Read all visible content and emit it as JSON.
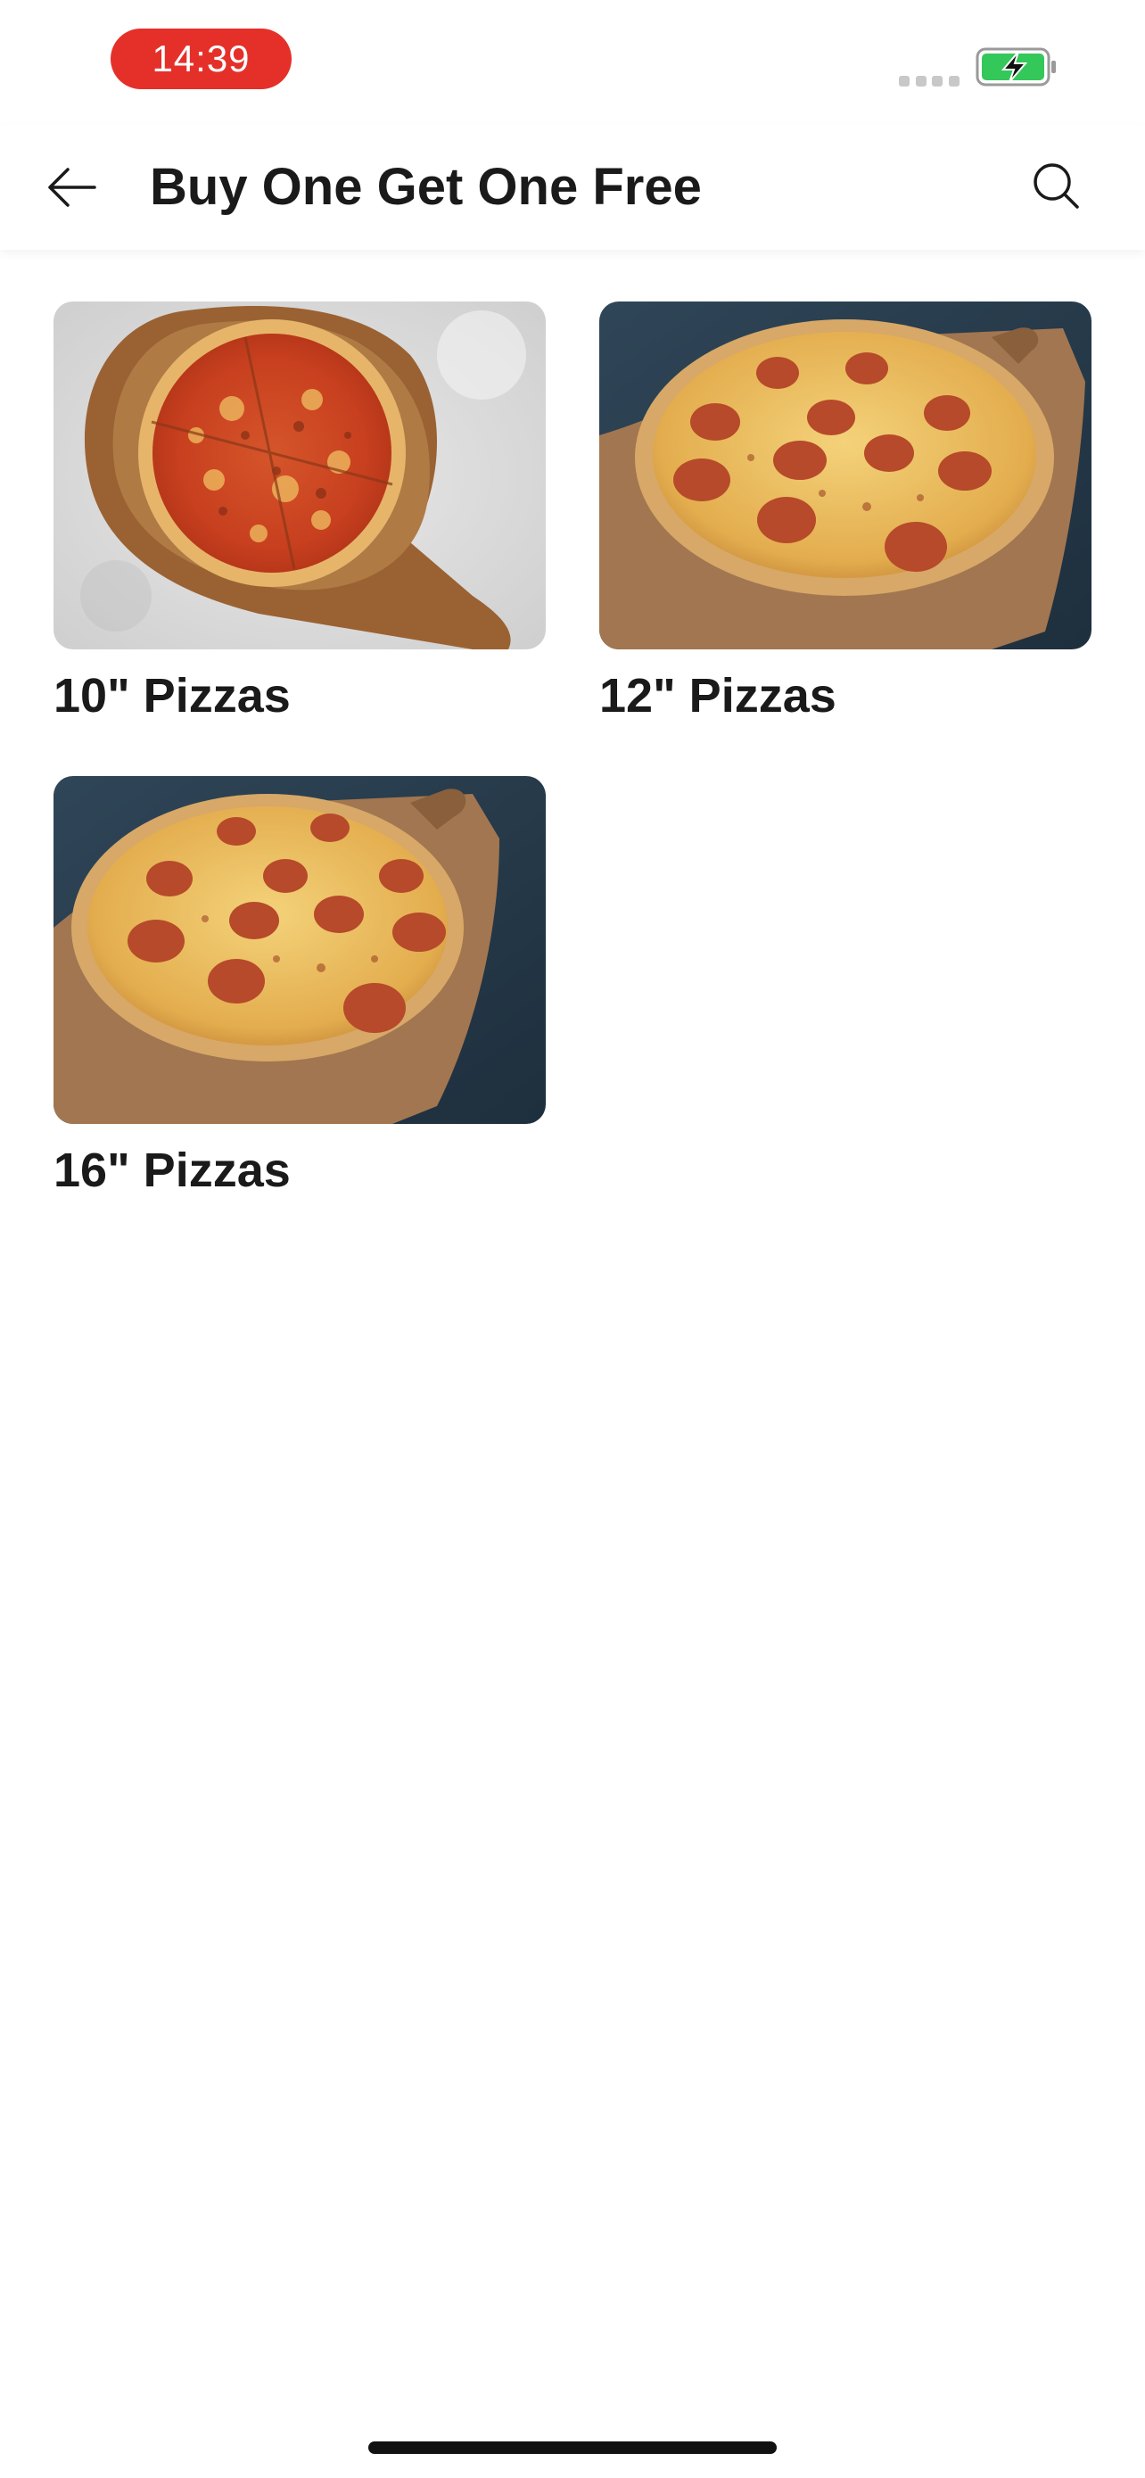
{
  "status_bar": {
    "time": "14:39",
    "time_pill_color": "#e5302a",
    "battery_color": "#34c759",
    "battery_state": "charging"
  },
  "header": {
    "title": "Buy One Get One Free",
    "back_icon": "arrow-left-icon",
    "search_icon": "search-icon"
  },
  "categories": [
    {
      "label": "10\" Pizzas",
      "image": "pizza-on-board-light-background"
    },
    {
      "label": "12\" Pizzas",
      "image": "pepperoni-pizza-dark-background"
    },
    {
      "label": "16\" Pizzas",
      "image": "pepperoni-pizza-dark-background"
    }
  ]
}
